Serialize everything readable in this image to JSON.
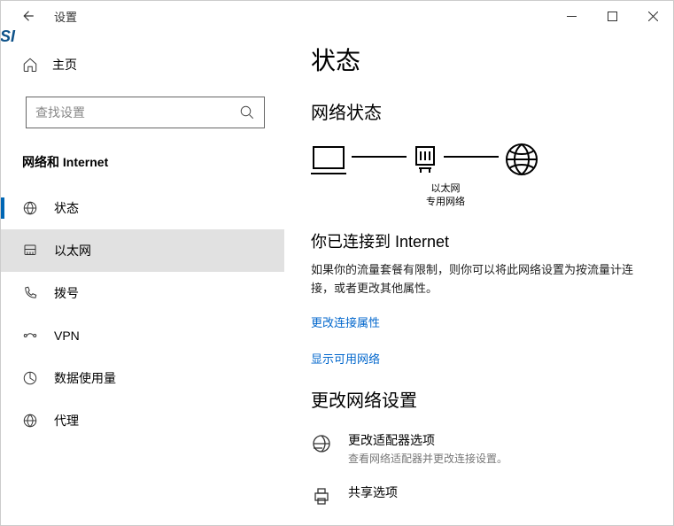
{
  "titlebar": {
    "title": "设置"
  },
  "sidebar": {
    "home_label": "主页",
    "search_placeholder": "查找设置",
    "section_label": "网络和 Internet",
    "items": [
      {
        "id": "status",
        "label": "状态",
        "active_indicator": true
      },
      {
        "id": "ethernet",
        "label": "以太网",
        "active": true
      },
      {
        "id": "dialup",
        "label": "拨号"
      },
      {
        "id": "vpn",
        "label": "VPN"
      },
      {
        "id": "datausage",
        "label": "数据使用量"
      },
      {
        "id": "proxy",
        "label": "代理"
      }
    ]
  },
  "main": {
    "h1": "状态",
    "h2": "网络状态",
    "diagram": {
      "device_label": "以太网",
      "network_type": "专用网络"
    },
    "connected_heading": "你已连接到 Internet",
    "connected_body": "如果你的流量套餐有限制，则你可以将此网络设置为按流量计连接，或者更改其他属性。",
    "link_props": "更改连接属性",
    "link_available": "显示可用网络",
    "h2b": "更改网络设置",
    "settings": [
      {
        "id": "adapter",
        "title": "更改适配器选项",
        "desc": "查看网络适配器并更改连接设置。"
      },
      {
        "id": "sharing",
        "title": "共享选项"
      }
    ]
  }
}
